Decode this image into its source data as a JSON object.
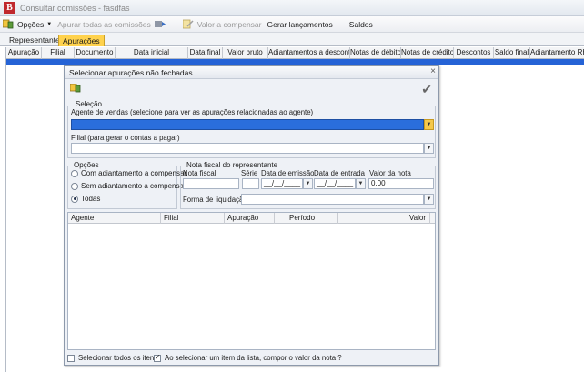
{
  "window": {
    "title": "Consultar comissões - fasdfas",
    "logo_letter": "B"
  },
  "toolbar": {
    "options_label": "Opções",
    "apurar_label": "Apurar todas as comissões",
    "valor_label": "Valor a compensar",
    "gerar_label": "Gerar lançamentos",
    "saldos_label": "Saldos"
  },
  "tabs": [
    {
      "label": "Representantes"
    },
    {
      "label": "Apurações"
    }
  ],
  "main_grid": {
    "columns": [
      "Apuração",
      "Filial",
      "Documento",
      "Data inicial",
      "Data final",
      "Valor bruto",
      "Adiantamentos a descontar",
      "Notas de débito",
      "Notas de crédito",
      "Descontos",
      "Saldo final",
      "Adiantamento RH"
    ]
  },
  "dialog": {
    "title": "Selecionar apurações não fechadas",
    "selecao_label": "Seleção",
    "agente_label": "Agente de vendas (selecione para ver as apurações relacionadas ao agente)",
    "agente_value": "",
    "filial_label": "Filial (para gerar o contas a pagar)",
    "filial_value": "",
    "opcoes_label": "Opções",
    "opcoes": [
      {
        "label": "Com adiantamento a compensar",
        "selected": false
      },
      {
        "label": "Sem adiantamento a compensar",
        "selected": false
      },
      {
        "label": "Todas",
        "selected": true
      }
    ],
    "nota_group_label": "Nota fiscal do representante",
    "nota_fiscal_label": "Nota fiscal",
    "nota_fiscal_value": "",
    "serie_label": "Série",
    "serie_value": "",
    "data_emissao_label": "Data de emissão",
    "data_emissao_value": "__/__/____",
    "data_entrada_label": "Data de entrada",
    "data_entrada_value": "__/__/____",
    "valor_nota_label": "Valor da nota",
    "valor_nota_value": "0,00",
    "forma_label": "Forma de liquidação",
    "forma_value": "",
    "list_columns": [
      "Agente",
      "Filial",
      "Apuração",
      "Período",
      "Valor"
    ],
    "select_all_label": "Selecionar todos os itens",
    "select_all_checked": false,
    "compor_label": "Ao selecionar um item da lista, compor o valor da nota ?",
    "compor_checked": true
  },
  "colors": {
    "accent_tab": "#ffd24d",
    "selection": "#2563d6",
    "agent_field": "#2a6edc",
    "logo": "#c0282d"
  }
}
